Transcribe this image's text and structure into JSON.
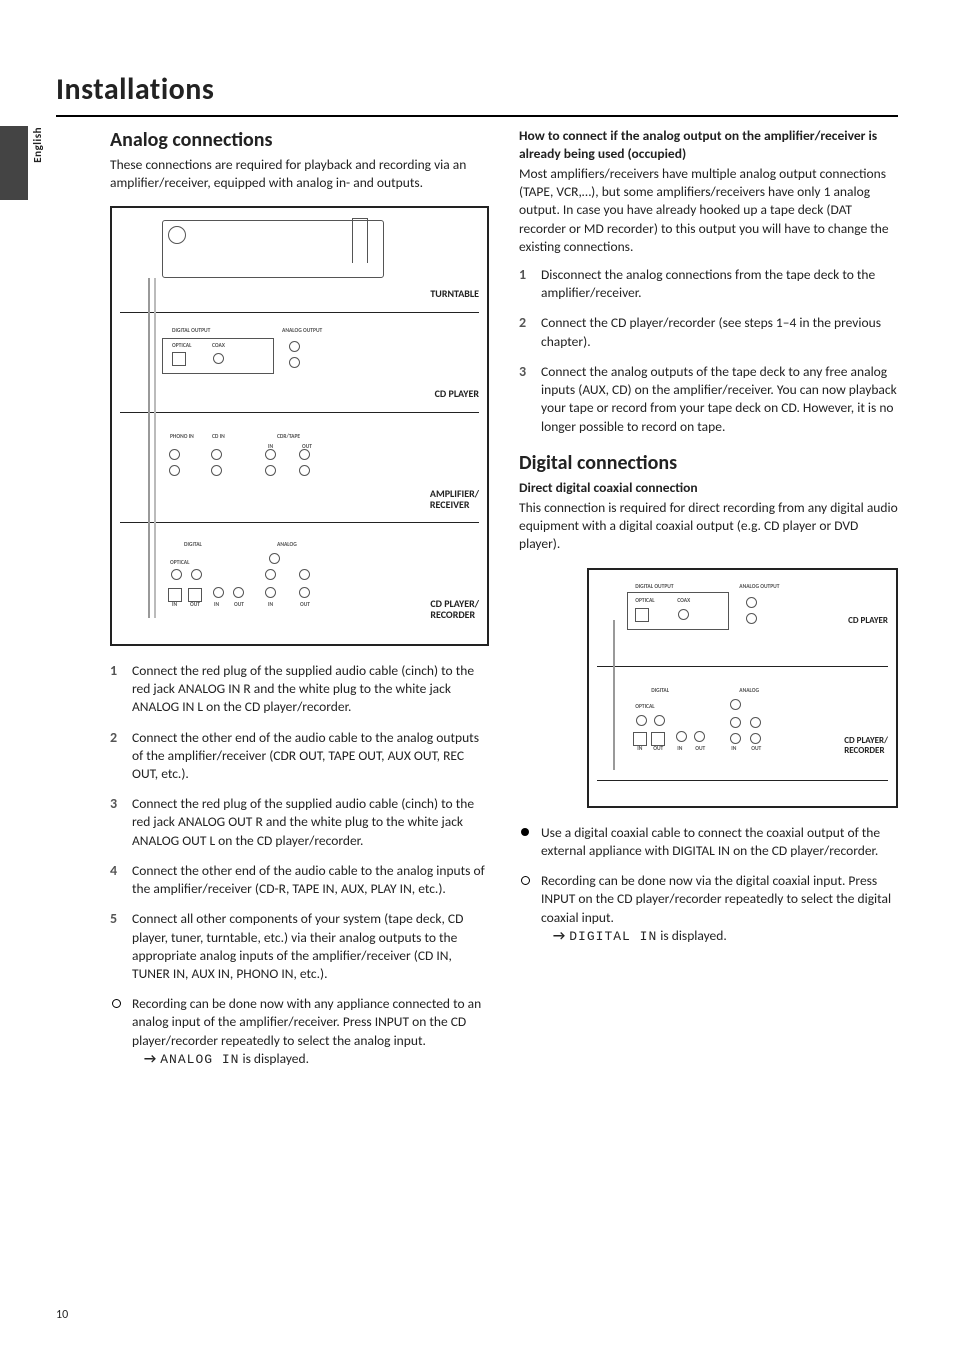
{
  "language_tab": "English",
  "doc_title": "Installations",
  "page_number": "10",
  "left": {
    "section_heading": "Analog connections",
    "intro": "These connections are required for playback and recording via an amplifier/receiver, equipped with analog in- and outputs.",
    "diagram": {
      "labels": {
        "turntable": "TURNTABLE",
        "cd_player": "CD PLAYER",
        "amp": "AMPLIFIER/\nRECEIVER",
        "cdr": "CD PLAYER/\nRECORDER",
        "digital_output": "DIGITAL OUTPUT",
        "analog_output": "ANALOG OUTPUT",
        "optical": "OPTICAL",
        "coax": "COAX",
        "phono_in": "PHONO IN",
        "cd_in": "CD IN",
        "cdr_tape": "CDR/TAPE",
        "in": "IN",
        "out": "OUT",
        "digital": "DIGITAL",
        "analog": "ANALOG"
      }
    },
    "steps": [
      "Connect the red plug of the supplied audio cable (cinch) to the red jack ANALOG IN R and the white plug to the white jack ANALOG IN L on the CD player/recorder.",
      "Connect the other end of the audio cable to the analog outputs of the amplifier/receiver (CDR OUT, TAPE OUT, AUX OUT, REC OUT, etc.).",
      "Connect the red plug of the supplied audio cable (cinch) to the red jack ANALOG OUT R and the white plug to the white jack ANALOG OUT L on the CD player/recorder.",
      "Connect the other end of the audio cable to the analog inputs of the amplifier/receiver (CD-R, TAPE IN, AUX, PLAY IN, etc.).",
      "Connect all other components of your system (tape deck, CD player, tuner, turntable, etc.) via their analog outputs to the appropriate analog inputs of the amplifier/receiver (CD IN, TUNER IN, AUX IN, PHONO IN, etc.)."
    ],
    "note": {
      "text": "Recording can be done now with any appliance connected to an analog input of the amplifier/receiver. Press INPUT on the CD player/recorder repeatedly to select the analog input.",
      "result_display": "ANALOG IN",
      "result_suffix": " is displayed."
    }
  },
  "right": {
    "howto_heading": "How to connect if the analog output on the amplifier/receiver is already being used (occupied)",
    "howto_intro": "Most amplifiers/receivers have multiple analog output connections (TAPE, VCR,…), but some amplifiers/receivers have only 1 analog output. In case you have already hooked up a tape deck (DAT recorder or MD recorder) to this output you will have to change the existing connections.",
    "howto_steps": [
      "Disconnect the analog connections from the tape deck to the amplifier/receiver.",
      "Connect the CD player/recorder (see steps 1–4 in the previous chapter).",
      "Connect the analog outputs of the tape deck to any free analog inputs (AUX, CD) on the amplifier/receiver. You can now playback your tape or record from your tape deck on CD. However, it is no longer possible to record on tape."
    ],
    "section_heading": "Digital connections",
    "subhead": "Direct digital coaxial connection",
    "intro": "This connection is required for direct recording from any digital audio equipment with a digital coaxial output (e.g. CD player or DVD player).",
    "diagram": {
      "labels": {
        "cd_player": "CD PLAYER",
        "cdr": "CD PLAYER/\nRECORDER",
        "digital_output": "DIGITAL OUTPUT",
        "analog_output": "ANALOG OUTPUT",
        "optical": "OPTICAL",
        "coax": "COAX",
        "digital": "DIGITAL",
        "analog": "ANALOG",
        "in": "IN",
        "out": "OUT"
      }
    },
    "bullets": [
      {
        "marker": "solid",
        "text": "Use a digital coaxial cable to connect the coaxial output of the external appliance with DIGITAL IN on the CD player/recorder."
      }
    ],
    "note": {
      "text": "Recording can be done now via the digital coaxial input. Press INPUT on the CD player/recorder repeatedly to select the digital coaxial input.",
      "result_display": "DIGITAL IN",
      "result_suffix": " is displayed."
    }
  }
}
